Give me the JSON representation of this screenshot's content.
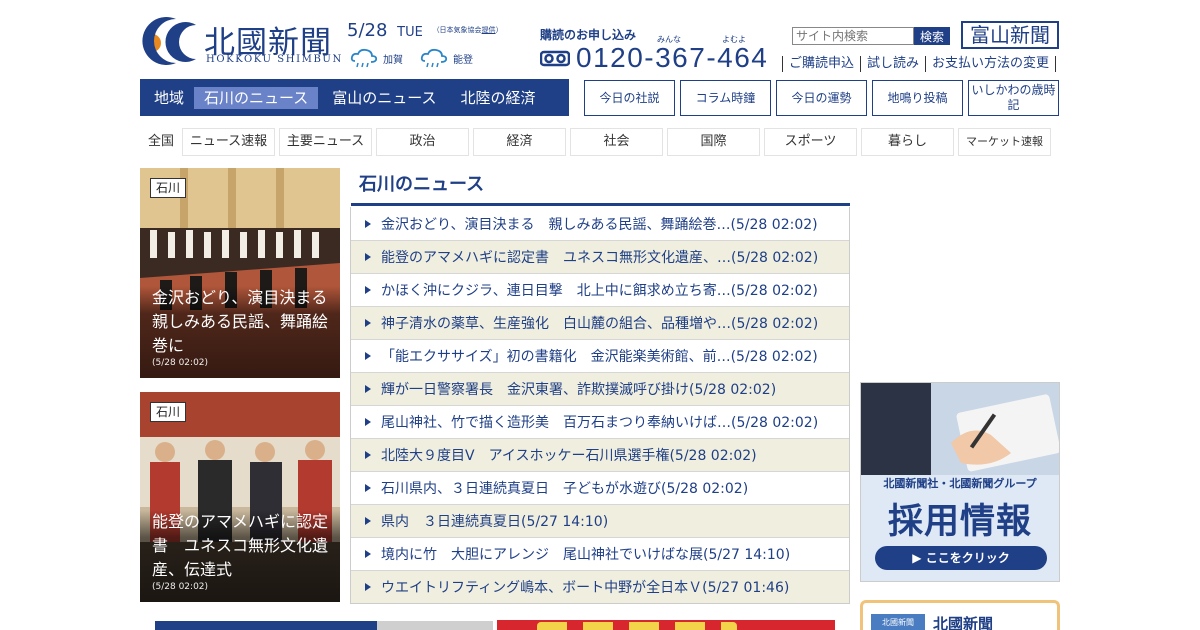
{
  "header": {
    "logo_jp": "北國新聞",
    "logo_en": "HOKKOKU SHIMBUN",
    "date": "5/28",
    "weekday": "TUE",
    "weather_source": "（日本気象協会",
    "weather_source_link": "提供",
    "weather_source_end": "）",
    "weather": [
      {
        "area": "加賀",
        "icon": "rain-cloud-icon"
      },
      {
        "area": "能登",
        "icon": "rain-cloud-icon"
      }
    ],
    "subscribe_label": "購読のお申し込み",
    "phone_ruby": [
      "みんな",
      "よむよ"
    ],
    "phone_number": "0120-367-464",
    "search_placeholder": "サイト内検索",
    "search_button": "検索",
    "toyama_button": "富山新聞",
    "sub_links": [
      "ご購読申込",
      "試し読み",
      "お支払い方法の変更"
    ]
  },
  "region_nav": {
    "label": "地域",
    "items": [
      {
        "label": "石川のニュース",
        "active": true
      },
      {
        "label": "富山のニュース",
        "active": false
      },
      {
        "label": "北陸の経済",
        "active": false
      }
    ]
  },
  "box_buttons": [
    "今日の社説",
    "コラム時鐘",
    "今日の運勢",
    "地鳴り投稿",
    "いしかわの歳時記"
  ],
  "categories": {
    "label": "全国",
    "items": [
      "ニュース速報",
      "主要ニュース",
      "政治",
      "経済",
      "社会",
      "国際",
      "スポーツ",
      "暮らし",
      "マーケット速報"
    ]
  },
  "photos": [
    {
      "tag": "石川",
      "title": "金沢おどり、演目決まる　親しみある民謡、舞踊絵巻に",
      "time": "(5/28 02:02)"
    },
    {
      "tag": "石川",
      "title": "能登のアマメハギに認定書　ユネスコ無形文化遺産、伝達式",
      "time": "(5/28 02:02)"
    }
  ],
  "news": {
    "title": "石川のニュース",
    "items": [
      "金沢おどり、演目決まる　親しみある民謡、舞踊絵巻…(5/28 02:02)",
      "能登のアマメハギに認定書　ユネスコ無形文化遺産、…(5/28 02:02)",
      "かほく沖にクジラ、連日目撃　北上中に餌求め立ち寄…(5/28 02:02)",
      "神子清水の薬草、生産強化　白山麓の組合、品種増や…(5/28 02:02)",
      "「能エクササイズ」初の書籍化　金沢能楽美術館、前…(5/28 02:02)",
      "輝が一日警察署長　金沢東署、詐欺撲滅呼び掛け(5/28 02:02)",
      "尾山神社、竹で描く造形美　百万石まつり奉納いけば…(5/28 02:02)",
      "北陸大９度目V　アイスホッケー石川県選手権(5/28 02:02)",
      "石川県内、３日連続真夏日　子どもが水遊び(5/28 02:02)",
      "県内　３日連続真夏日(5/27 14:10)",
      "境内に竹　大胆にアレンジ　尾山神社でいけばな展(5/27 14:10)",
      "ウエイトリフティング嶋本、ボート中野が全日本Ｖ(5/27 01:46)"
    ]
  },
  "recruit_banner": {
    "org": "北國新聞社・北國新聞グループ",
    "title": "採用情報",
    "button": "▶ ここをクリック"
  },
  "promo_banner": {
    "logo": "北國新聞",
    "text": "北國新聞"
  },
  "colors": {
    "brand": "#1f3f86",
    "nav_active": "#6a82c7",
    "alt_row": "#f0efdf",
    "recruit_bg": "#dfe9f5"
  }
}
